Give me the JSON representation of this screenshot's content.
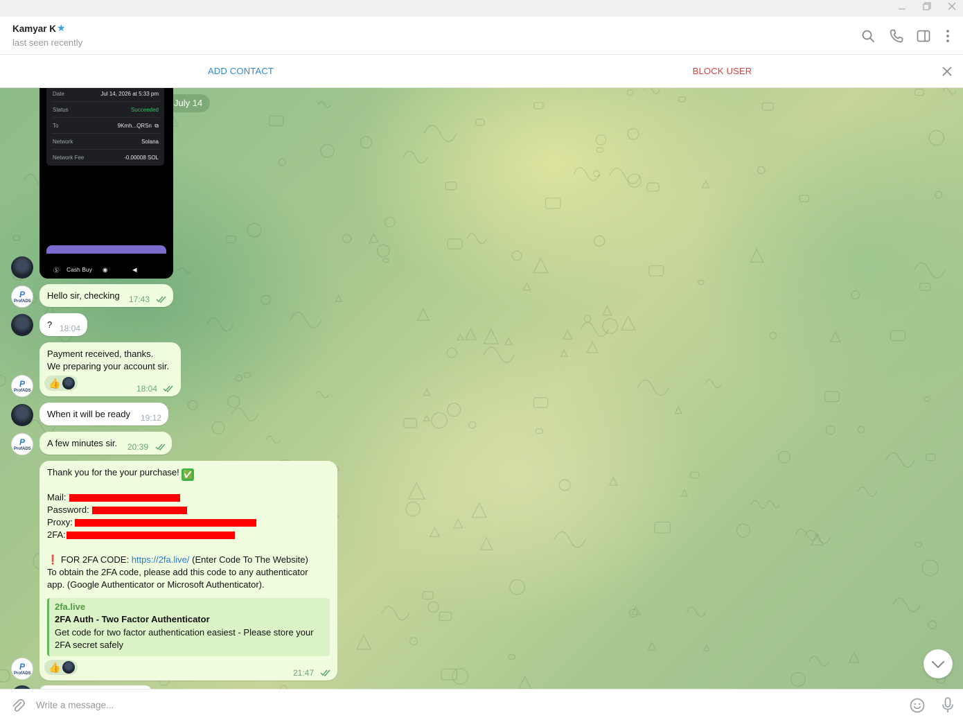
{
  "window": {
    "minimize_icon": "minimize-icon",
    "restore_icon": "restore-icon",
    "close_icon": "close-icon"
  },
  "header": {
    "contact_name": "Kamyar K",
    "status": "last seen recently",
    "icons": [
      "search-icon",
      "phone-icon",
      "sidebar-toggle-icon",
      "more-vertical-icon"
    ]
  },
  "action_bar": {
    "add_contact": "ADD CONTACT",
    "block_user": "BLOCK USER"
  },
  "chat": {
    "date_pill": "July 14",
    "image_message": {
      "rows": [
        {
          "label": "Date",
          "value": "Jul 14, 2026 at 5:33 pm"
        },
        {
          "label": "Status",
          "value": "Succeeded"
        },
        {
          "label": "To",
          "value": "9Kmh...QRSn"
        },
        {
          "label": "Network",
          "value": "Solana"
        },
        {
          "label": "Network Fee",
          "value": "-0.00008 SOL"
        }
      ],
      "nav": "Cash Buy"
    },
    "messages": [
      {
        "text": "Hello sir, checking",
        "time": "17:43"
      },
      {
        "text": "?",
        "time": "18:04"
      },
      {
        "line1": "Payment received, thanks.",
        "line2": "We preparing your account sir.",
        "reaction": "👍",
        "time": "18:04"
      },
      {
        "text": "When it will be ready",
        "time": "19:12"
      },
      {
        "text": "A few minutes sir.",
        "time": "20:39"
      }
    ],
    "final": {
      "heading": "Thank you for the your purchase!",
      "check": "✅",
      "mail_label": "Mail:",
      "password_label": "Password:",
      "proxy_label": "Proxy:",
      "twofa_label": "2FA:",
      "exclaim": "❗",
      "code_prefix": "FOR 2FA CODE:",
      "code_link": "https://2fa.live/",
      "code_suffix": "(Enter Code To The Website)",
      "info_line1": "To obtain the 2FA code, please add this code to any authenticator",
      "info_line2": "app. (Google Authenticator or Microsoft Authenticator).",
      "preview_site": "2fa.live",
      "preview_title": "2FA Auth - Two Factor Authenticator",
      "preview_desc": "Get code for two factor authentication easiest - Please store your 2FA secret safely",
      "reaction": "👍",
      "time": "21:47"
    },
    "avatar_brand": "ProfADS"
  },
  "composer": {
    "placeholder": "Write a message..."
  },
  "colors": {
    "link": "#2a7bd0",
    "block": "#d9413e",
    "bubble_out": "#effdde",
    "tick": "#5fa26b"
  }
}
